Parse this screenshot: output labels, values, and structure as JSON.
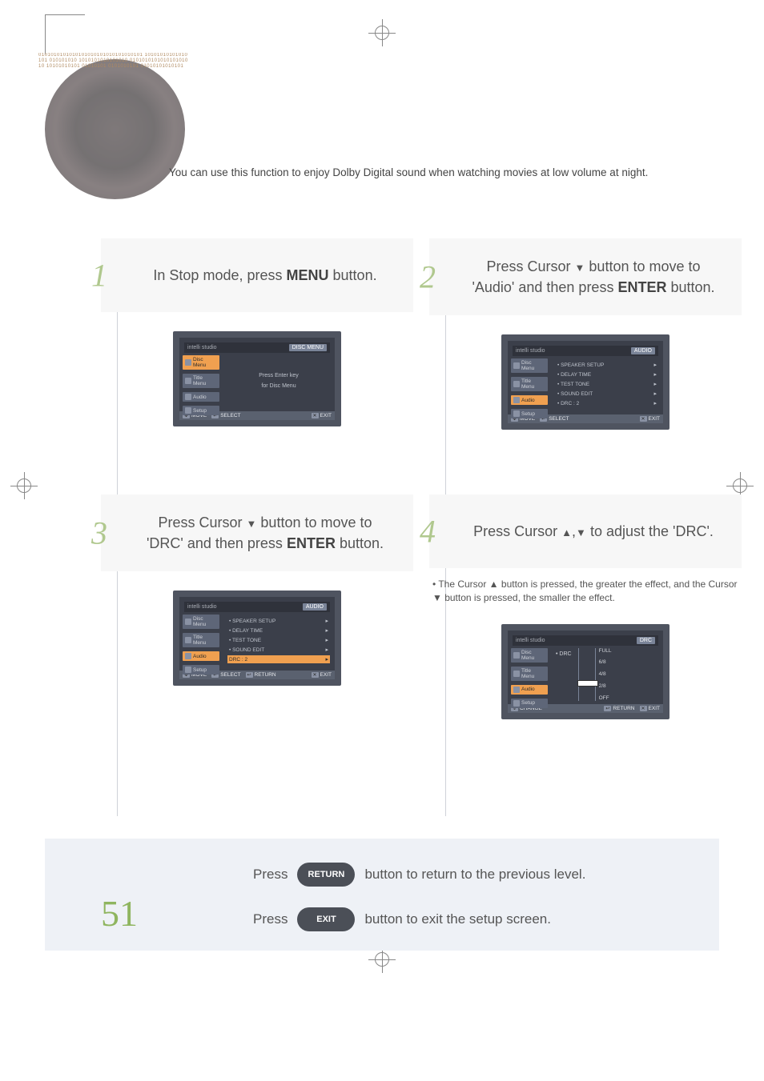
{
  "page_number": "51",
  "intro": "You can use this function to enjoy Dolby Digital sound when watching movies at low volume at night.",
  "steps": {
    "s1": {
      "num": "1",
      "line1": "In Stop mode, press",
      "btn": "MENU",
      "line2": "button.",
      "osd": {
        "brand": "intelli studio",
        "tab": "DISC MENU",
        "side": [
          "Disc Menu",
          "Title Menu",
          "Audio",
          "Setup"
        ],
        "msg1": "Press Enter key",
        "msg2": "for Disc Menu",
        "foot_move": "MOVE",
        "foot_select": "SELECT",
        "foot_exit": "EXIT"
      }
    },
    "s2": {
      "num": "2",
      "line1": "Press Cursor",
      "line2": "button to move to 'Audio' and then press",
      "btn": "ENTER",
      "line3": "button.",
      "osd": {
        "brand": "intelli studio",
        "tab": "AUDIO",
        "side": [
          "Disc Menu",
          "Title Menu",
          "Audio",
          "Setup"
        ],
        "items": [
          {
            "label": "SPEAKER SETUP",
            "val": ""
          },
          {
            "label": "DELAY TIME",
            "val": ""
          },
          {
            "label": "TEST TONE",
            "val": ""
          },
          {
            "label": "SOUND EDIT",
            "val": ""
          },
          {
            "label": "DRC",
            "val": ": 2"
          }
        ],
        "foot_move": "MOVE",
        "foot_select": "SELECT",
        "foot_exit": "EXIT"
      }
    },
    "s3": {
      "num": "3",
      "line1": "Press Cursor",
      "line2": "button to move to 'DRC' and then press",
      "btn": "ENTER",
      "line3": "button.",
      "osd": {
        "brand": "intelli studio",
        "tab": "AUDIO",
        "side": [
          "Disc Menu",
          "Title Menu",
          "Audio",
          "Setup"
        ],
        "items": [
          {
            "label": "SPEAKER SETUP",
            "val": ""
          },
          {
            "label": "DELAY TIME",
            "val": ""
          },
          {
            "label": "TEST TONE",
            "val": ""
          },
          {
            "label": "SOUND EDIT",
            "val": ""
          },
          {
            "label": "DRC",
            "val": ": 2",
            "hl": true
          }
        ],
        "foot_move": "MOVE",
        "foot_select": "SELECT",
        "foot_return": "RETURN",
        "foot_exit": "EXIT"
      }
    },
    "s4": {
      "num": "4",
      "line1": "Press Cursor",
      "line2": "to adjust the 'DRC'.",
      "bullet": "The Cursor ▲ button is pressed, the greater the effect, and the Cursor ▼ button is pressed, the smaller the effect.",
      "osd": {
        "brand": "intelli studio",
        "tab": "DRC",
        "side": [
          "Disc Menu",
          "Title Menu",
          "Audio",
          "Setup"
        ],
        "drc_label": "DRC",
        "scale": [
          "FULL",
          "6/8",
          "4/8",
          "2/8",
          "OFF"
        ],
        "foot_change": "CHANGE",
        "foot_return": "RETURN",
        "foot_exit": "EXIT"
      }
    }
  },
  "footer": {
    "press": "Press",
    "return_btn": "RETURN",
    "return_txt": "button to return to the previous level.",
    "exit_btn": "EXIT",
    "exit_txt": "button to exit the setup screen."
  }
}
